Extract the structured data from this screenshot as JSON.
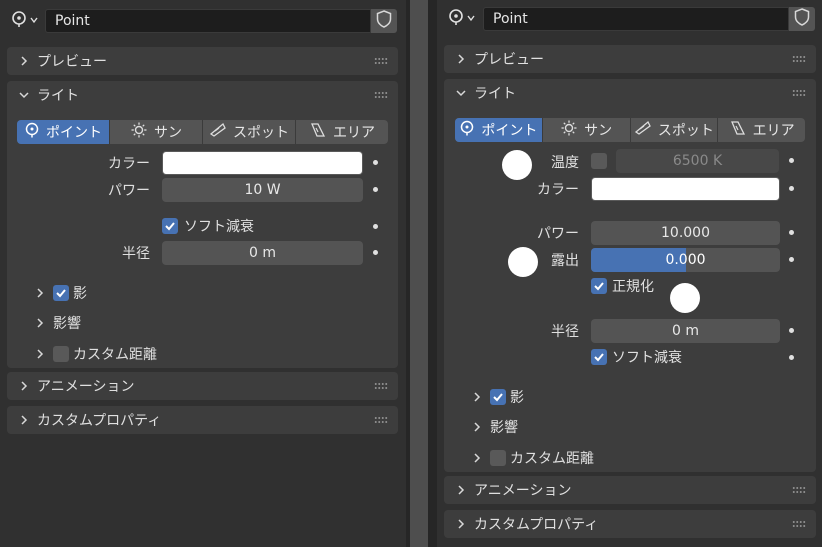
{
  "left": {
    "header": {
      "object_name": "Point"
    },
    "panels": {
      "preview": "プレビュー",
      "light": "ライト",
      "animation": "アニメーション",
      "custom_props": "カスタムプロパティ"
    },
    "light_types": [
      "ポイント",
      "サン",
      "スポット",
      "エリア"
    ],
    "fields": {
      "color_label": "カラー",
      "power_label": "パワー",
      "power_value": "10 W",
      "soft_falloff_label": "ソフト減衰",
      "radius_label": "半径",
      "radius_value": "0 m"
    },
    "subpanels": {
      "shadow": "影",
      "influence": "影響",
      "custom_distance": "カスタム距離"
    }
  },
  "right": {
    "header": {
      "object_name": "Point"
    },
    "panels": {
      "preview": "プレビュー",
      "light": "ライト",
      "animation": "アニメーション",
      "custom_props": "カスタムプロパティ"
    },
    "light_types": [
      "ポイント",
      "サン",
      "スポット",
      "エリア"
    ],
    "fields": {
      "temperature_label": "温度",
      "temperature_value": "6500 K",
      "color_label": "カラー",
      "power_label": "パワー",
      "power_value": "10.000",
      "exposure_label": "露出",
      "exposure_value": "0.000",
      "normalize_label": "正規化",
      "radius_label": "半径",
      "radius_value": "0 m",
      "soft_falloff_label": "ソフト減衰"
    },
    "subpanels": {
      "shadow": "影",
      "influence": "影響",
      "custom_distance": "カスタム距離"
    }
  },
  "colors": {
    "accent": "#4772b3",
    "panel": "#3d3d3d",
    "field": "#545454",
    "background": "#303030",
    "light_color": "#ffffff"
  }
}
